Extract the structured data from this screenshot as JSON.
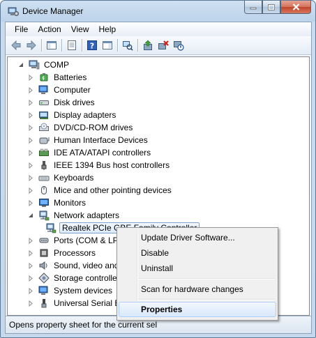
{
  "window": {
    "title": "Device Manager",
    "icon": "device-manager-icon",
    "caption_buttons": [
      "minimize-icon",
      "maximize-icon",
      "close-icon"
    ]
  },
  "menubar": {
    "items": [
      "File",
      "Action",
      "View",
      "Help"
    ]
  },
  "toolbar": {
    "buttons": [
      "back-arrow-icon",
      "forward-arrow-icon",
      "show-hide-console-tree-icon",
      "properties-icon",
      "help-icon",
      "show-hide-action-pane-icon",
      "scan-hardware-changes-icon",
      "update-driver-icon",
      "uninstall-icon",
      "disable-icon"
    ]
  },
  "tree": {
    "root": "COMP",
    "categories": [
      {
        "label": "Batteries",
        "icon": "battery-icon"
      },
      {
        "label": "Computer",
        "icon": "computer-icon"
      },
      {
        "label": "Disk drives",
        "icon": "disk-drive-icon"
      },
      {
        "label": "Display adapters",
        "icon": "display-adapter-icon"
      },
      {
        "label": "DVD/CD-ROM drives",
        "icon": "dvd-drive-icon"
      },
      {
        "label": "Human Interface Devices",
        "icon": "hid-icon"
      },
      {
        "label": "IDE ATA/ATAPI controllers",
        "icon": "ide-controller-icon"
      },
      {
        "label": "IEEE 1394 Bus host controllers",
        "icon": "ieee1394-icon"
      },
      {
        "label": "Keyboards",
        "icon": "keyboard-icon"
      },
      {
        "label": "Mice and other pointing devices",
        "icon": "mouse-icon"
      },
      {
        "label": "Monitors",
        "icon": "monitor-icon"
      },
      {
        "label": "Network adapters",
        "icon": "network-adapter-icon",
        "expanded": true
      },
      {
        "label": "Ports (COM & LPT)",
        "icon": "port-icon"
      },
      {
        "label": "Processors",
        "icon": "processor-icon"
      },
      {
        "label": "Sound, video and game controllers",
        "icon": "sound-icon"
      },
      {
        "label": "Storage controllers",
        "icon": "storage-controller-icon"
      },
      {
        "label": "System devices",
        "icon": "system-device-icon"
      },
      {
        "label": "Universal Serial Bus controllers",
        "icon": "usb-icon"
      }
    ],
    "selected_device": "Realtek PCIe GBE Family Controller"
  },
  "context_menu": {
    "items": [
      {
        "label": "Update Driver Software..."
      },
      {
        "label": "Disable"
      },
      {
        "label": "Uninstall"
      },
      {
        "label": "Scan for hardware changes"
      },
      {
        "label": "Properties",
        "bold": true,
        "hover": true
      }
    ]
  },
  "statusbar": {
    "text": "Opens property sheet for the current sel"
  }
}
